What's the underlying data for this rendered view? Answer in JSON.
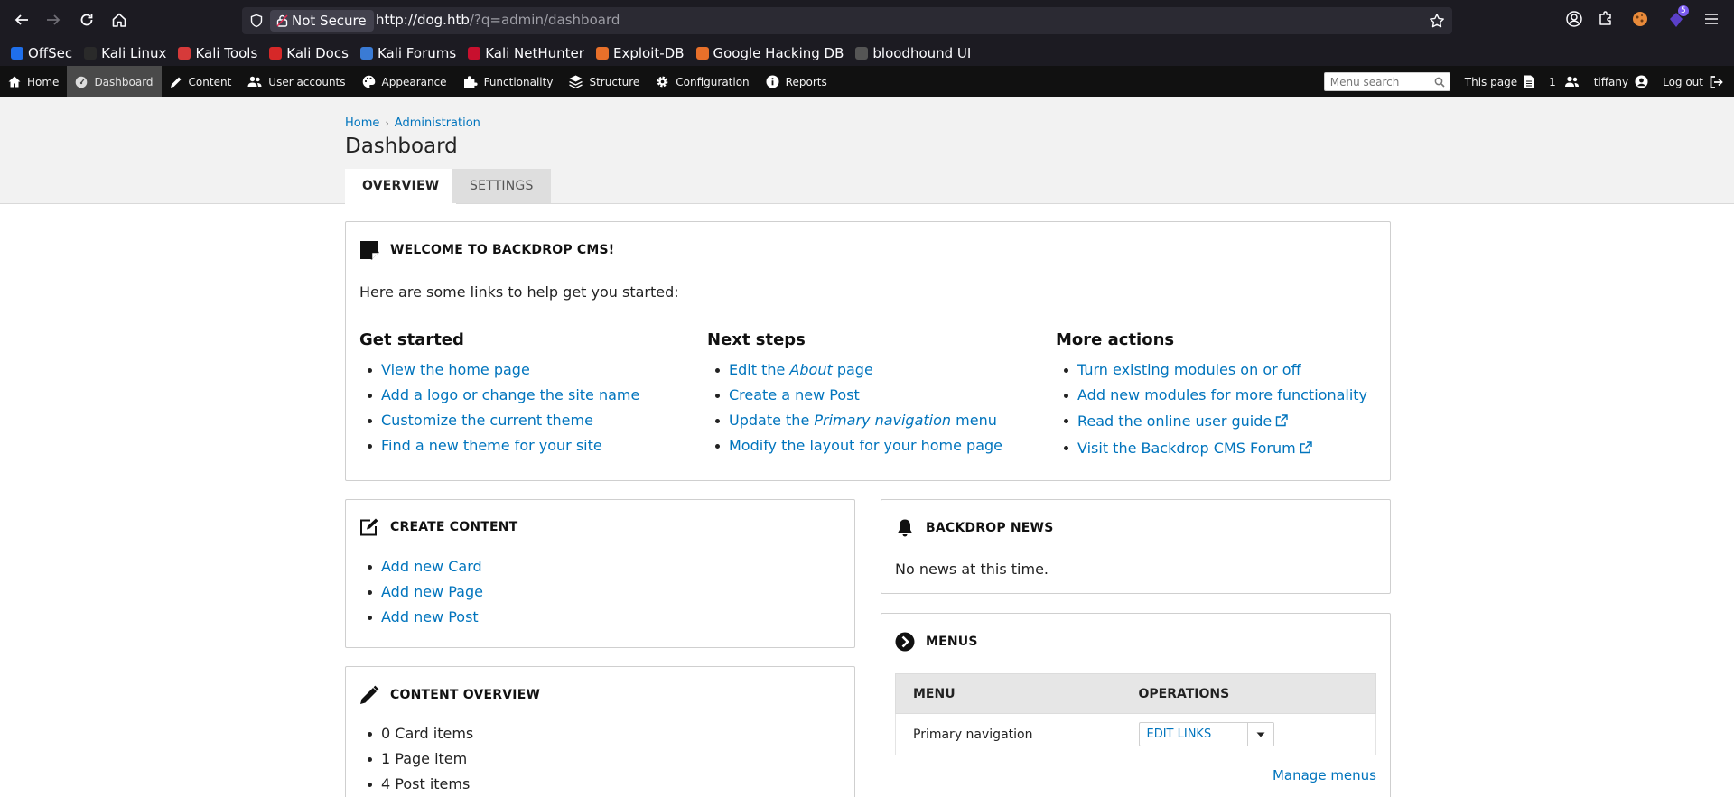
{
  "browser": {
    "security_label": "Not Secure",
    "url_host": "http://dog.htb",
    "url_path": "/?q=admin/dashboard",
    "extension_badge": "5",
    "bookmarks": [
      {
        "label": "OffSec",
        "color": "#1f6feb"
      },
      {
        "label": "Kali Linux",
        "color": "#2a2a2a"
      },
      {
        "label": "Kali Tools",
        "color": "#d63a3a"
      },
      {
        "label": "Kali Docs",
        "color": "#d62828"
      },
      {
        "label": "Kali Forums",
        "color": "#3a7bd5"
      },
      {
        "label": "Kali NetHunter",
        "color": "#c8102e"
      },
      {
        "label": "Exploit-DB",
        "color": "#e8702a"
      },
      {
        "label": "Google Hacking DB",
        "color": "#e8702a"
      },
      {
        "label": "bloodhound UI",
        "color": "#555555"
      }
    ]
  },
  "admin_bar": {
    "items": [
      {
        "label": "Home",
        "icon": "home-icon"
      },
      {
        "label": "Dashboard",
        "icon": "dashboard-icon"
      },
      {
        "label": "Content",
        "icon": "pencil-icon"
      },
      {
        "label": "User accounts",
        "icon": "users-icon"
      },
      {
        "label": "Appearance",
        "icon": "palette-icon"
      },
      {
        "label": "Functionality",
        "icon": "puzzle-icon"
      },
      {
        "label": "Structure",
        "icon": "stack-icon"
      },
      {
        "label": "Configuration",
        "icon": "gear-icon"
      },
      {
        "label": "Reports",
        "icon": "info-icon"
      }
    ],
    "menu_search_placeholder": "Menu search",
    "this_page": "This page",
    "user_count": "1",
    "username": "tiffany",
    "logout": "Log out"
  },
  "header": {
    "breadcrumb": [
      "Home",
      "Administration"
    ],
    "title": "Dashboard",
    "tabs": [
      "OVERVIEW",
      "SETTINGS"
    ]
  },
  "welcome": {
    "title": "WELCOME TO BACKDROP CMS!",
    "intro": "Here are some links to help get you started:",
    "columns": [
      {
        "title": "Get started",
        "links": [
          "View the home page",
          "Add a logo or change the site name",
          "Customize the current theme",
          "Find a new theme for your site"
        ]
      },
      {
        "title": "Next steps",
        "links": [
          "Edit the About page",
          "Create a new Post",
          "Update the Primary navigation menu",
          "Modify the layout for your home page"
        ]
      },
      {
        "title": "More actions",
        "links": [
          "Turn existing modules on or off",
          "Add new modules for more functionality",
          "Read the online user guide",
          "Visit the Backdrop CMS Forum"
        ]
      }
    ],
    "next_steps_parts": {
      "edit_pre": "Edit the ",
      "edit_em": "About",
      "edit_post": " page",
      "update_pre": "Update the ",
      "update_em": "Primary navigation",
      "update_post": " menu"
    }
  },
  "create_content": {
    "title": "CREATE CONTENT",
    "links": [
      "Add new Card",
      "Add new Page",
      "Add new Post"
    ]
  },
  "backdrop_news": {
    "title": "BACKDROP NEWS",
    "text": "No news at this time."
  },
  "content_overview": {
    "title": "CONTENT OVERVIEW",
    "items": [
      "0 Card items",
      "1 Page item",
      "4 Post items"
    ]
  },
  "menus": {
    "title": "MENUS",
    "headers": [
      "MENU",
      "OPERATIONS"
    ],
    "rows": [
      {
        "menu": "Primary navigation",
        "operation": "EDIT LINKS"
      }
    ],
    "manage_link": "Manage menus"
  }
}
